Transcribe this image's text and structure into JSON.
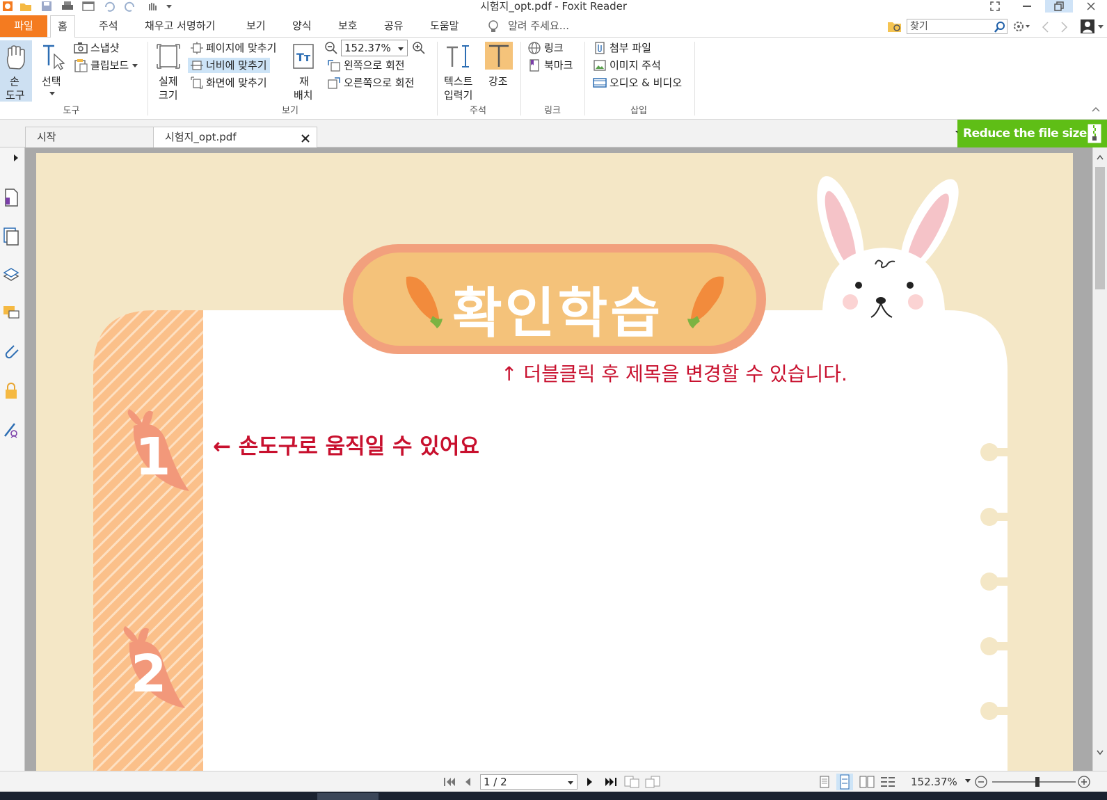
{
  "window": {
    "title": "시험지_opt.pdf - Foxit Reader"
  },
  "menu": {
    "tabs": [
      "파일",
      "홈",
      "주석",
      "채우고 서명하기",
      "보기",
      "양식",
      "보호",
      "공유",
      "도움말"
    ],
    "tell_me": "알려 주세요...",
    "search_placeholder": "찾기"
  },
  "ribbon": {
    "tools": {
      "hand_line1": "손",
      "hand_line2": "도구",
      "select": "선택",
      "snapshot": "스냅샷",
      "clipboard": "클립보드",
      "group": "도구"
    },
    "view": {
      "actual_line1": "실제",
      "actual_line2": "크기",
      "fit_page": "페이지에 맞추기",
      "fit_width": "너비에 맞추기",
      "fit_visible": "화면에 맞추기",
      "reflow_line1": "재",
      "reflow_line2": "배치",
      "zoom_value": "152.37%",
      "rotate_left": "왼쪽으로 회전",
      "rotate_right": "오른쪽으로 회전",
      "group": "보기"
    },
    "comment": {
      "typewriter_line1": "텍스트",
      "typewriter_line2": "입력기",
      "highlight": "강조",
      "group": "주석"
    },
    "links": {
      "link": "링크",
      "bookmark": "북마크",
      "group": "링크"
    },
    "insert": {
      "attachment": "첨부 파일",
      "image_annotation": "이미지 주석",
      "audio_video": "오디오 & 비디오",
      "group": "삽입"
    }
  },
  "doc_tabs": {
    "start": "시작",
    "file": "시험지_opt.pdf",
    "reduce": "Reduce the file size"
  },
  "pdf": {
    "title": "확인학습",
    "hint_title": "↑  더블클릭 후 제목을 변경할 수 있습니다.",
    "hint_hand": "← 손도구로 움직일 수 있어요",
    "numbers": [
      "1",
      "2"
    ]
  },
  "status": {
    "page": "1 / 2",
    "zoom": "152.37%"
  },
  "colors": {
    "file_tab": "#f47b20",
    "reduce_button": "#5fbe16",
    "page_bg": "#f4e7c6",
    "title_badge": "#f4c27a",
    "title_border": "#f2a07d",
    "hint_red": "#c8102e",
    "stripe_orange": "#fbc08a"
  }
}
